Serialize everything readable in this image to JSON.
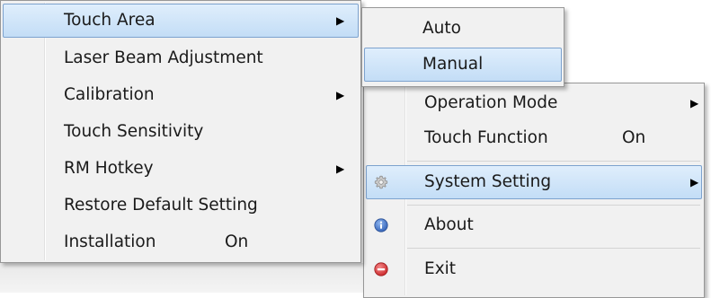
{
  "main_menu": {
    "items": [
      {
        "label": "Operation Mode",
        "has_submenu": true
      },
      {
        "label": "Touch Function",
        "value": "On"
      },
      {
        "label": "System Setting",
        "has_submenu": true,
        "icon": "gear-icon",
        "highlighted": true
      },
      {
        "label": "About",
        "icon": "info-icon"
      },
      {
        "label": "Exit",
        "icon": "exit-icon"
      }
    ]
  },
  "system_setting_menu": {
    "items": [
      {
        "label": "Touch Area",
        "has_submenu": true,
        "highlighted": true
      },
      {
        "label": "Laser Beam Adjustment"
      },
      {
        "label": "Calibration",
        "has_submenu": true
      },
      {
        "label": "Touch Sensitivity"
      },
      {
        "label": "RM Hotkey",
        "has_submenu": true
      },
      {
        "label": "Restore Default Setting"
      },
      {
        "label": "Installation",
        "value": "On"
      }
    ]
  },
  "touch_area_menu": {
    "items": [
      {
        "label": "Auto"
      },
      {
        "label": "Manual",
        "highlighted": true
      }
    ]
  },
  "glyphs": {
    "arrow": "▶"
  },
  "colors": {
    "highlight_border": "#7da2ce",
    "highlight_fill": "#c3ddf6",
    "info_blue": "#3b6fc4",
    "exit_red": "#d7373a"
  }
}
